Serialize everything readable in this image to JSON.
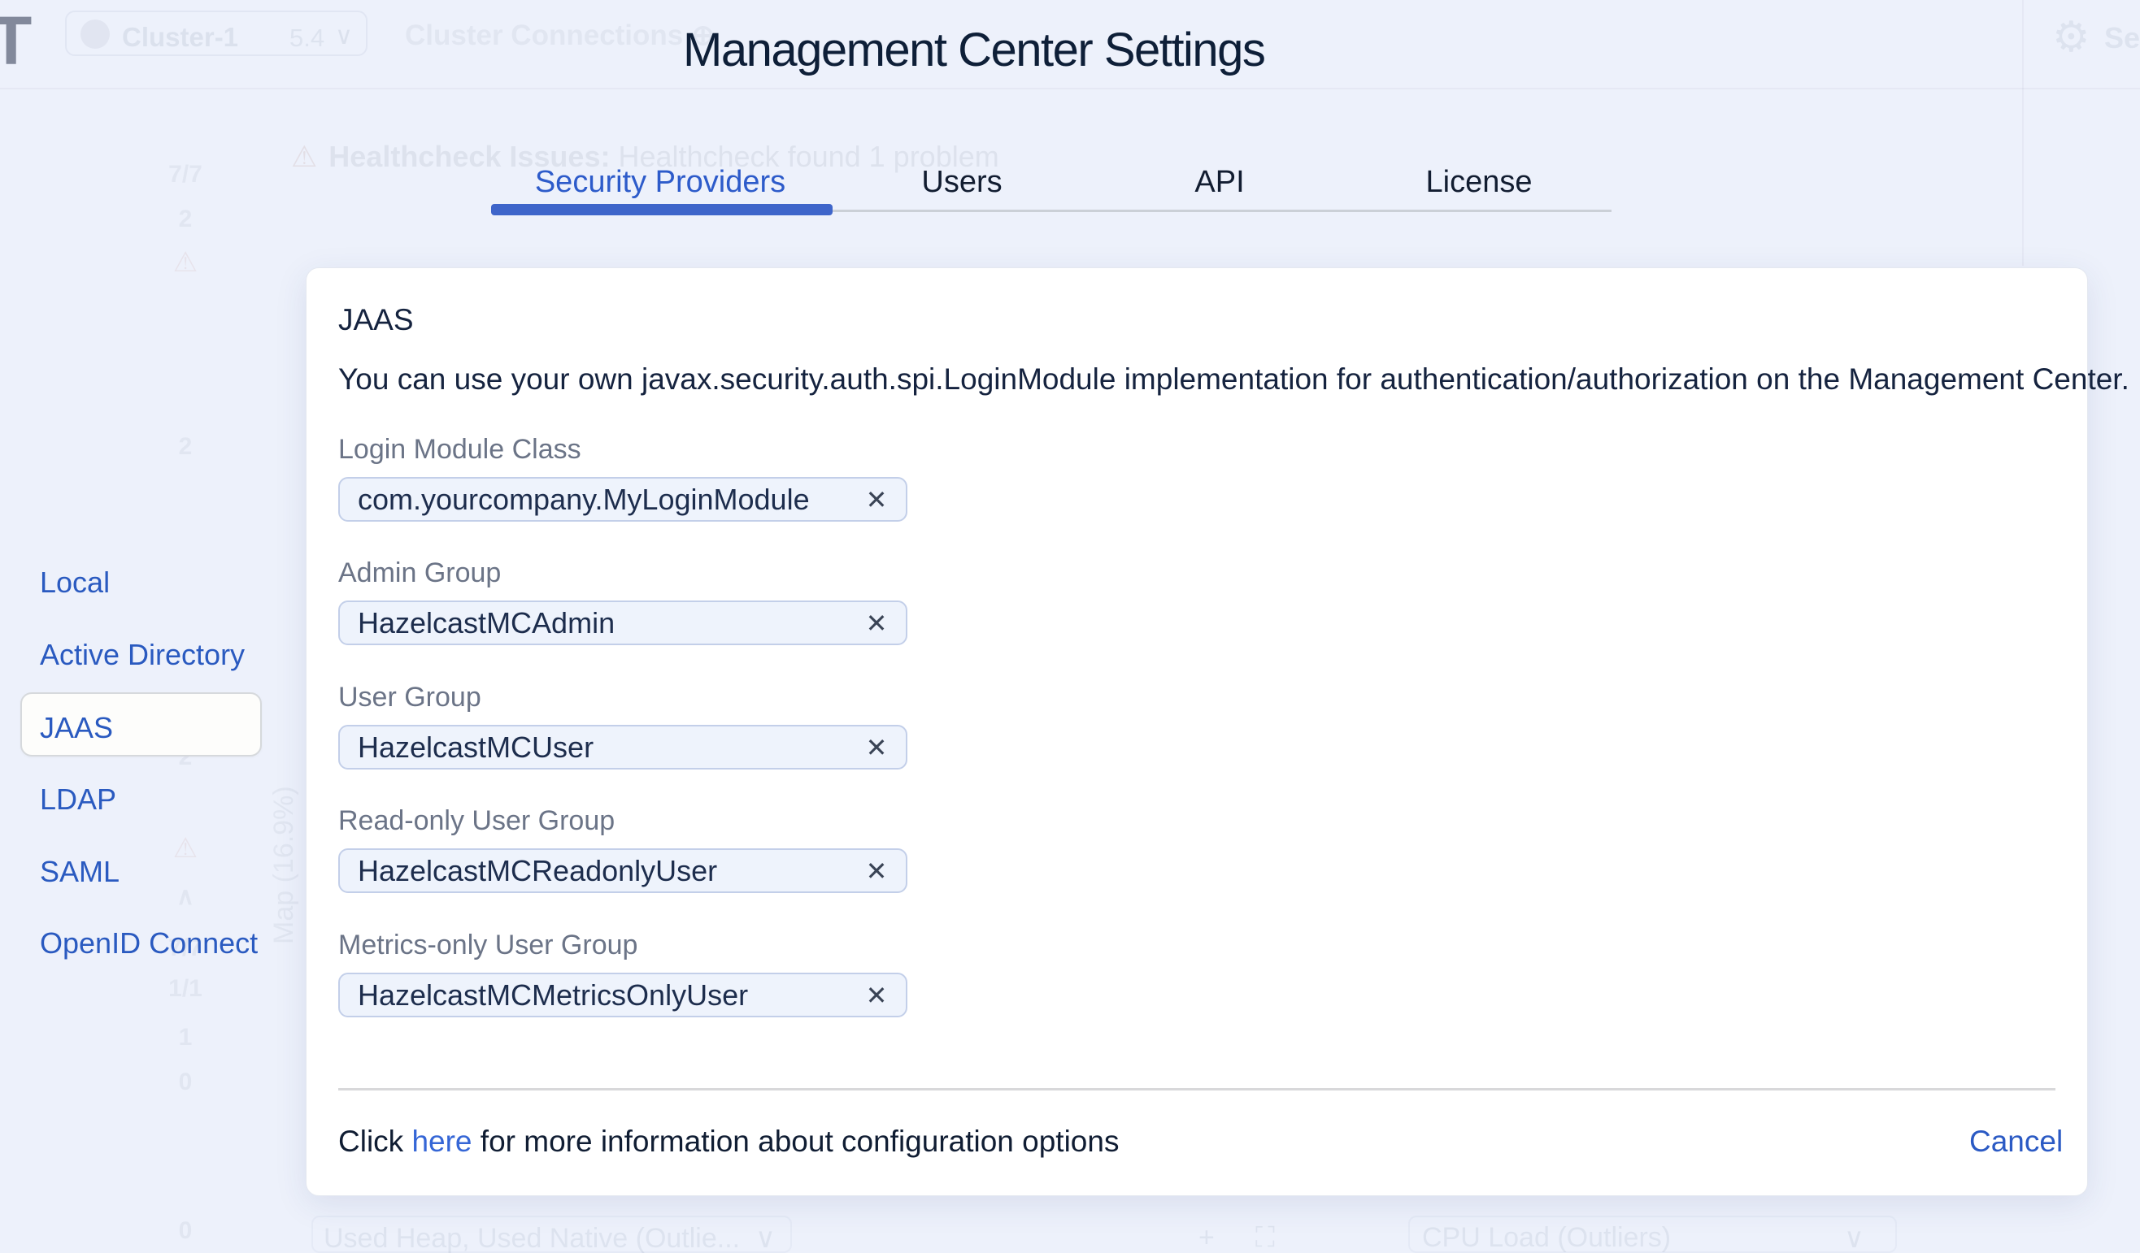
{
  "colors": {
    "backdrop": "#edf1fb",
    "accent_blue": "#2d5bca",
    "tab_underline": "#3e65ca",
    "sidebar_blue": "#2a5ac0",
    "link_blue": "#3566d6",
    "cancel_blue": "#2b5ac4",
    "panel_bg": "#ffffff",
    "input_bg": "#eef3fc",
    "input_border": "#c3cfe9",
    "label_gray": "#6b7487",
    "text_dark": "#111f38"
  },
  "icons": {
    "clear": "✕",
    "chevron_down": "∨",
    "chevron_up": "∧",
    "warning": "⚠",
    "gear": "⚙",
    "plus": "+",
    "expand": "⛶",
    "circle_plus": "⊕"
  },
  "dialog": {
    "title": "Management Center Settings",
    "tabs": [
      {
        "label": "Security Providers",
        "active": true
      },
      {
        "label": "Users",
        "active": false
      },
      {
        "label": "API",
        "active": false
      },
      {
        "label": "License",
        "active": false
      }
    ],
    "sidebar": {
      "selected": "JAAS",
      "items": [
        {
          "label": "Local"
        },
        {
          "label": "Active Directory"
        },
        {
          "label": "JAAS"
        },
        {
          "label": "LDAP"
        },
        {
          "label": "SAML"
        },
        {
          "label": "OpenID Connect"
        }
      ]
    },
    "panel": {
      "heading": "JAAS",
      "description": "You can use your own javax.security.auth.spi.LoginModule implementation for authentication/authorization on the Management Center.",
      "fields": [
        {
          "label": "Login Module Class",
          "value": "com.yourcompany.MyLoginModule"
        },
        {
          "label": "Admin Group",
          "value": "HazelcastMCAdmin"
        },
        {
          "label": "User Group",
          "value": "HazelcastMCUser"
        },
        {
          "label": "Read-only User Group",
          "value": "HazelcastMCReadonlyUser"
        },
        {
          "label": "Metrics-only User Group",
          "value": "HazelcastMCMetricsOnlyUser"
        }
      ],
      "footer": {
        "pre": "Click ",
        "link": "here",
        "post": " for more information about configuration options",
        "cancel": "Cancel"
      }
    }
  },
  "background": {
    "logo": "T",
    "cluster_pill": {
      "name": "Cluster-1",
      "version": "5.4"
    },
    "cluster_connections": "Cluster Connections",
    "healthcheck_bold": "Healthcheck Issues:",
    "healthcheck_rest": " Healthcheck found 1 problem",
    "settings": "Settings",
    "rail": [
      "7/7",
      "2",
      "2",
      "2",
      "7/7",
      "1/1",
      "1",
      "0",
      "0"
    ],
    "map_label": "Map (16.9%)",
    "used_heap": "Used Heap, Used Native (Outlie...",
    "cpu_load": "CPU Load (Outliers)",
    "zero": "0"
  }
}
